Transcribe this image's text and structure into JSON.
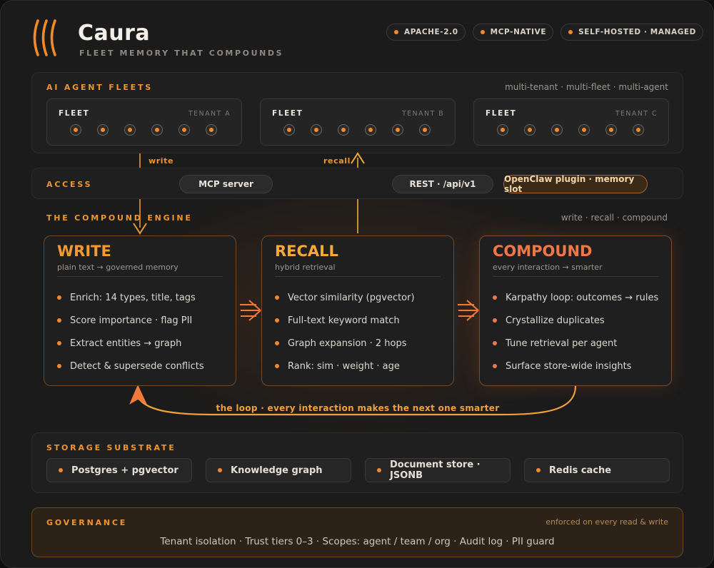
{
  "header": {
    "title": "Caura",
    "subtitle": "FLEET MEMORY THAT COMPOUNDS",
    "badges": [
      "APACHE-2.0",
      "MCP-NATIVE",
      "SELF-HOSTED · MANAGED"
    ]
  },
  "fleets": {
    "label": "AI AGENT FLEETS",
    "note": "multi-tenant · multi-fleet · multi-agent",
    "items": [
      {
        "name": "FLEET",
        "tenant": "TENANT A",
        "agents": 6
      },
      {
        "name": "FLEET",
        "tenant": "TENANT B",
        "agents": 6
      },
      {
        "name": "FLEET",
        "tenant": "TENANT C",
        "agents": 6
      }
    ]
  },
  "flows": {
    "write": "write",
    "recall": "recall"
  },
  "access": {
    "label": "ACCESS",
    "items": [
      "MCP server",
      "REST · /api/v1",
      "OpenClaw plugin · memory slot"
    ]
  },
  "engine": {
    "label": "THE COMPOUND ENGINE",
    "note": "write · recall · compound",
    "boxes": [
      {
        "title": "WRITE",
        "subtitle": "plain text → governed memory",
        "color": "#f29a2e",
        "items": [
          "Enrich: 14 types, title, tags",
          "Score importance · flag PII",
          "Extract entities → graph",
          "Detect & supersede conflicts"
        ]
      },
      {
        "title": "RECALL",
        "subtitle": "hybrid retrieval",
        "color": "#f5aa36",
        "items": [
          "Vector similarity (pgvector)",
          "Full-text keyword match",
          "Graph expansion · 2 hops",
          "Rank: sim · weight · age"
        ]
      },
      {
        "title": "COMPOUND",
        "subtitle": "every interaction → smarter",
        "color": "#f07848",
        "items": [
          "Karpathy loop: outcomes → rules",
          "Crystallize duplicates",
          "Tune retrieval per agent",
          "Surface store-wide insights"
        ]
      }
    ],
    "loop": "the loop · every interaction makes the next one smarter"
  },
  "storage": {
    "label": "STORAGE SUBSTRATE",
    "items": [
      "Postgres + pgvector",
      "Knowledge graph",
      "Document store · JSONB",
      "Redis cache"
    ]
  },
  "governance": {
    "label": "GOVERNANCE",
    "note": "enforced on every read & write",
    "text": "Tenant isolation · Trust tiers 0–3 · Scopes: agent / team / org · Audit log · PII guard"
  },
  "colors": {
    "accent": "#f08a2a",
    "compound": "#f07848",
    "loop": "#f0a03a"
  }
}
